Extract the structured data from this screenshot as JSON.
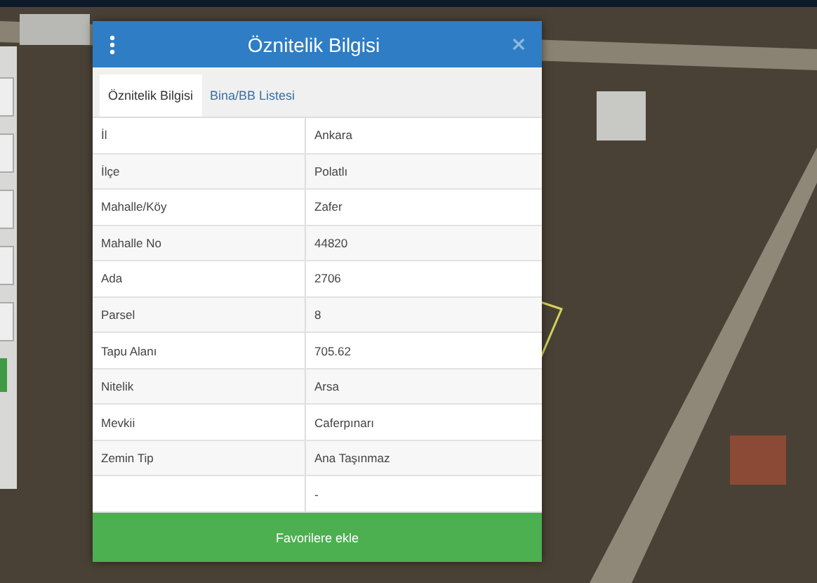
{
  "dialog": {
    "title": "Öznitelik Bilgisi",
    "tabs": [
      {
        "label": "Öznitelik Bilgisi",
        "selected": true
      },
      {
        "label": "Bina/BB Listesi",
        "selected": false
      }
    ],
    "rows": [
      {
        "name": "İl",
        "value": "Ankara"
      },
      {
        "name": "İlçe",
        "value": "Polatlı"
      },
      {
        "name": "Mahalle/Köy",
        "value": "Zafer"
      },
      {
        "name": "Mahalle No",
        "value": "44820"
      },
      {
        "name": "Ada",
        "value": "2706"
      },
      {
        "name": "Parsel",
        "value": "8"
      },
      {
        "name": "Tapu Alanı",
        "value": "705.62"
      },
      {
        "name": "Nitelik",
        "value": "Arsa"
      },
      {
        "name": "Mevkii",
        "value": "Caferpınarı"
      },
      {
        "name": "Zemin Tip",
        "value": "Ana Taşınmaz"
      },
      {
        "name": "",
        "value": "-"
      }
    ],
    "button": "Favorilere ekle"
  }
}
